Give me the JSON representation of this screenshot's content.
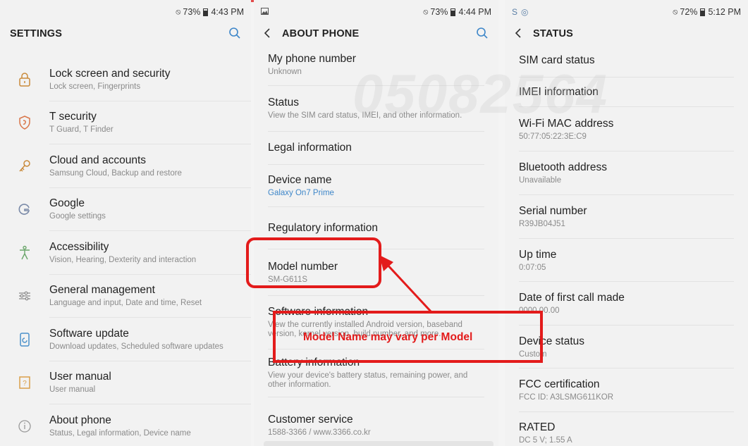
{
  "panel_settings": {
    "status": {
      "battery": "73%",
      "time": "4:43 PM"
    },
    "title": "SETTINGS",
    "items": [
      {
        "icon": "lock-icon",
        "title": "Lock screen and security",
        "desc": "Lock screen, Fingerprints"
      },
      {
        "icon": "shield-icon",
        "title": "T security",
        "desc": "T Guard, T Finder"
      },
      {
        "icon": "key-icon",
        "title": "Cloud and accounts",
        "desc": "Samsung Cloud, Backup and restore"
      },
      {
        "icon": "google-icon",
        "title": "Google",
        "desc": "Google settings"
      },
      {
        "icon": "accessibility-icon",
        "title": "Accessibility",
        "desc": "Vision, Hearing, Dexterity and interaction"
      },
      {
        "icon": "sliders-icon",
        "title": "General management",
        "desc": "Language and input, Date and time, Reset"
      },
      {
        "icon": "update-icon",
        "title": "Software update",
        "desc": "Download updates, Scheduled software updates"
      },
      {
        "icon": "manual-icon",
        "title": "User manual",
        "desc": "User manual"
      },
      {
        "icon": "info-icon",
        "title": "About phone",
        "desc": "Status, Legal information, Device name"
      }
    ]
  },
  "panel_about": {
    "status": {
      "battery": "73%",
      "time": "4:44 PM"
    },
    "title": "ABOUT PHONE",
    "watermark": "05082564",
    "items": [
      {
        "title": "My phone number",
        "desc": "Unknown"
      },
      {
        "title": "Status",
        "desc": "View the SIM card status, IMEI, and other information."
      },
      {
        "title": "Legal information",
        "desc": ""
      },
      {
        "title": "Device name",
        "desc": "Galaxy On7 Prime"
      },
      {
        "title": "Regulatory information",
        "desc": ""
      },
      {
        "title": "Model number",
        "desc": "SM-G611S"
      },
      {
        "title": "Software information",
        "desc": "View the currently installed Android version, baseband version, kernel version, build number, and more."
      },
      {
        "title": "Battery information",
        "desc": "View your device's battery status, remaining power, and other information."
      },
      {
        "title": "Customer service",
        "desc": "1588-3366 / www.3366.co.kr"
      }
    ]
  },
  "panel_status": {
    "status": {
      "battery": "72%",
      "time": "5:12 PM"
    },
    "title": "STATUS",
    "items": [
      {
        "title": "SIM card status",
        "desc": ""
      },
      {
        "title": "IMEI information",
        "desc": ""
      },
      {
        "title": "Wi-Fi MAC address",
        "desc": "50:77:05:22:3E:C9"
      },
      {
        "title": "Bluetooth address",
        "desc": "Unavailable"
      },
      {
        "title": "Serial number",
        "desc": "R39JB04J51"
      },
      {
        "title": "Up time",
        "desc": "0:07:05"
      },
      {
        "title": "Date of first call made",
        "desc": "0000.00.00"
      },
      {
        "title": "Device status",
        "desc": "Custom"
      },
      {
        "title": "FCC certification",
        "desc": "FCC ID: A3LSMG611KOR"
      },
      {
        "title": "RATED",
        "desc": "DC 5 V; 1.55 A"
      }
    ]
  },
  "annotation": {
    "callout_text": "Model Name may vary per Model",
    "color": "#e31b1b"
  },
  "colors": {
    "accent": "#3f87c9",
    "icon_orange": "#c98a3a",
    "background": "#f2f2f2"
  }
}
